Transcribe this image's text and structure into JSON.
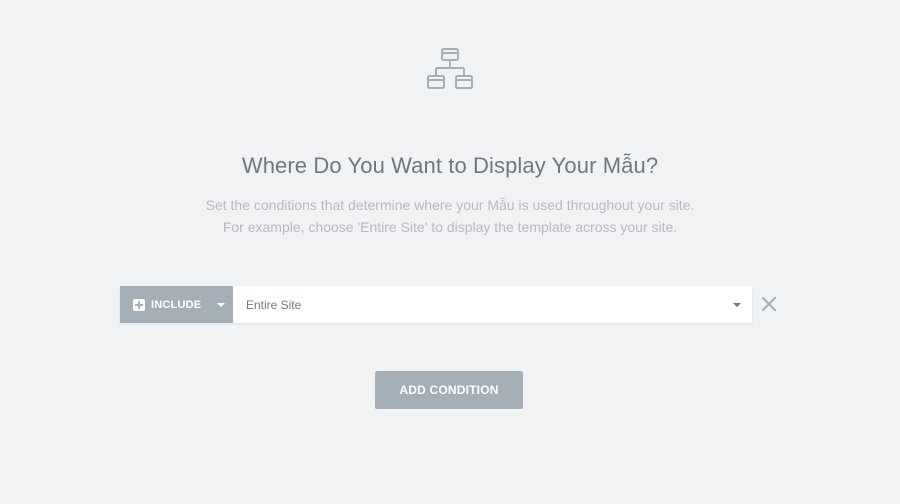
{
  "header": {
    "icon": "sitemap-icon",
    "title": "Where Do You Want to Display Your Mẫu?",
    "description_line1": "Set the conditions that determine where your Mẫu is used throughout your site.",
    "description_line2": "For example, choose 'Entire Site' to display the template across your site."
  },
  "condition": {
    "type_label": "INCLUDE",
    "value": "Entire Site"
  },
  "actions": {
    "add_condition_label": "ADD CONDITION"
  },
  "colors": {
    "background": "#f1f2f4",
    "accent_gray": "#a4afb7",
    "title_text": "#6d7882",
    "muted_text": "#b4bbc2"
  }
}
